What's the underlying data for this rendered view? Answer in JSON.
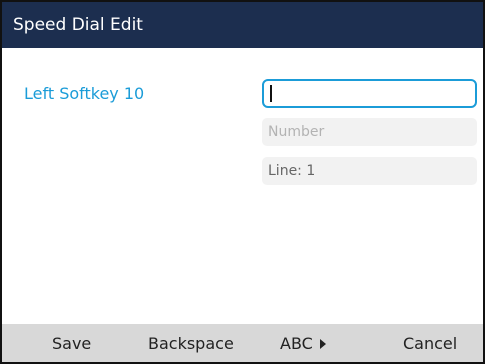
{
  "title_bar": {
    "title": "Speed Dial Edit"
  },
  "form": {
    "label": "Left Softkey 10",
    "name_input": {
      "value": "",
      "focused": true
    },
    "number_field": {
      "placeholder": "Number"
    },
    "line_field": {
      "value": "Line: 1"
    }
  },
  "softkeys": {
    "save": "Save",
    "backspace": "Backspace",
    "abc": "ABC",
    "abc_icon": "right-arrow-icon",
    "cancel": "Cancel"
  },
  "colors": {
    "title_bar_background": "#1c2e4f",
    "accent": "#1b9cd8",
    "softkey_bar_background": "#d8d8d8"
  }
}
